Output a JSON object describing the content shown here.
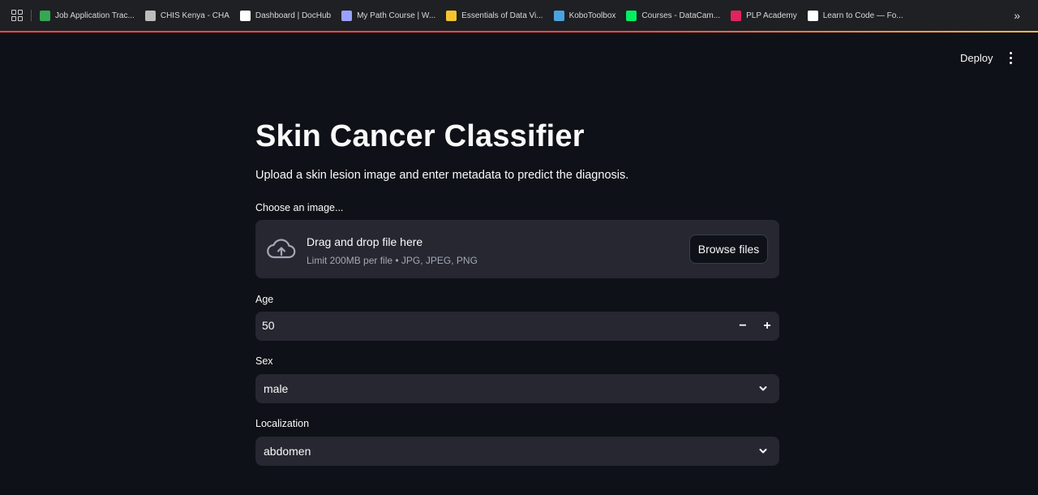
{
  "browser": {
    "bookmarks": [
      {
        "label": "Job Application Trac...",
        "icon": "sheets-icon",
        "color": "#34a853"
      },
      {
        "label": "CHIS Kenya - CHA",
        "icon": "globe-icon",
        "color": "#bdbdbd"
      },
      {
        "label": "Dashboard | DocHub",
        "icon": "dochub-icon",
        "color": "#ffffff"
      },
      {
        "label": "My Path Course | W...",
        "icon": "path-icon",
        "color": "#9aa0ff"
      },
      {
        "label": "Essentials of Data Vi...",
        "icon": "course-icon",
        "color": "#f4c430"
      },
      {
        "label": "KoboToolbox",
        "icon": "kobo-icon",
        "color": "#4aa3df"
      },
      {
        "label": "Courses - DataCam...",
        "icon": "datacamp-icon",
        "color": "#03ef62"
      },
      {
        "label": "PLP Academy",
        "icon": "plp-icon",
        "color": "#e0245e"
      },
      {
        "label": "Learn to Code — Fo...",
        "icon": "fcc-icon",
        "color": "#ffffff"
      }
    ],
    "more_icon": "chevron-double-right-icon"
  },
  "header": {
    "deploy_label": "Deploy",
    "menu_icon": "kebab-menu-icon"
  },
  "main": {
    "title": "Skin Cancer Classifier",
    "subtitle": "Upload a skin lesion image and enter metadata to predict the diagnosis.",
    "uploader": {
      "label": "Choose an image...",
      "drop_text": "Drag and drop file here",
      "limit_text": "Limit 200MB per file • JPG, JPEG, PNG",
      "browse_label": "Browse files"
    },
    "age": {
      "label": "Age",
      "value": "50",
      "minus": "−",
      "plus": "+"
    },
    "sex": {
      "label": "Sex",
      "value": "male"
    },
    "localization": {
      "label": "Localization",
      "value": "abdomen"
    }
  }
}
